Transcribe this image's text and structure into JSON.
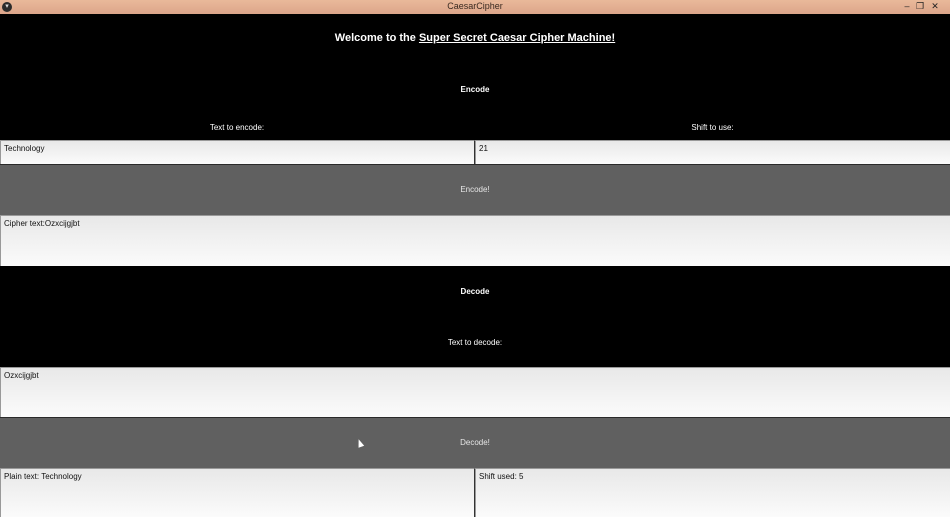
{
  "window": {
    "title": "CaesarCipher"
  },
  "welcome": {
    "prefix": "Welcome to the ",
    "emphasis": "Super Secret Caesar Cipher Machine!"
  },
  "encode": {
    "heading": "Encode",
    "text_label": "Text to encode:",
    "shift_label": "Shift to use:",
    "text_value": "Technology",
    "shift_value": "21",
    "button": "Encode!",
    "result": "Cipher text:Ozxcijgjbt"
  },
  "decode": {
    "heading": "Decode",
    "text_label": "Text to decode:",
    "text_value": "Ozxcijgjbt",
    "button": "Decode!",
    "plain_result": "Plain text: Technology",
    "shift_result": "Shift used: 5"
  },
  "colors": {
    "titlebar": "#e0aa8c",
    "background": "#000000",
    "button": "#606060",
    "field": "#f2f2f2"
  }
}
